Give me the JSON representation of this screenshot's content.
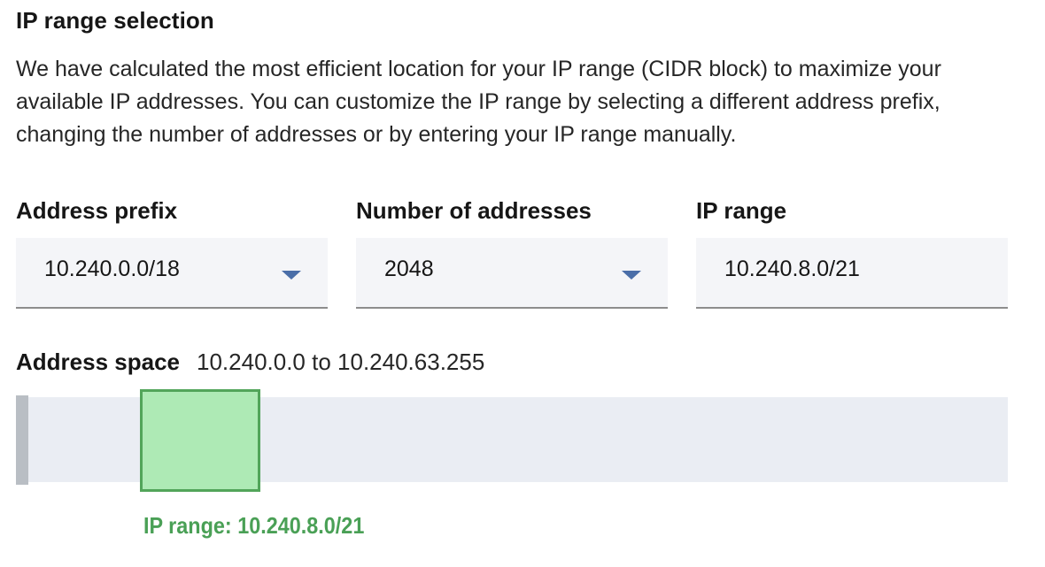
{
  "section": {
    "title": "IP range selection",
    "description": "We have calculated the most efficient location for your IP range (CIDR block) to maximize your available IP addresses. You can customize the IP range by selecting a different address prefix, changing the number of addresses or by entering your IP range manually."
  },
  "fields": {
    "address_prefix": {
      "label": "Address prefix",
      "value": "10.240.0.0/18",
      "icon": "chevron-down-icon"
    },
    "number_of_addresses": {
      "label": "Number of addresses",
      "value": "2048",
      "icon": "chevron-down-icon"
    },
    "ip_range": {
      "label": "IP range",
      "value": "10.240.8.0/21"
    }
  },
  "address_space": {
    "label": "Address space",
    "range_text": "10.240.0.0 to 10.240.63.255",
    "selected_caption": "IP range: 10.240.8.0/21",
    "selected_start_fraction": 0.125,
    "selected_size_fraction": 0.125
  },
  "colors": {
    "selected_fill": "#aeeab5",
    "selected_border": "#52a55a",
    "track": "#eaedf3",
    "caret": "#4a6ea8"
  }
}
